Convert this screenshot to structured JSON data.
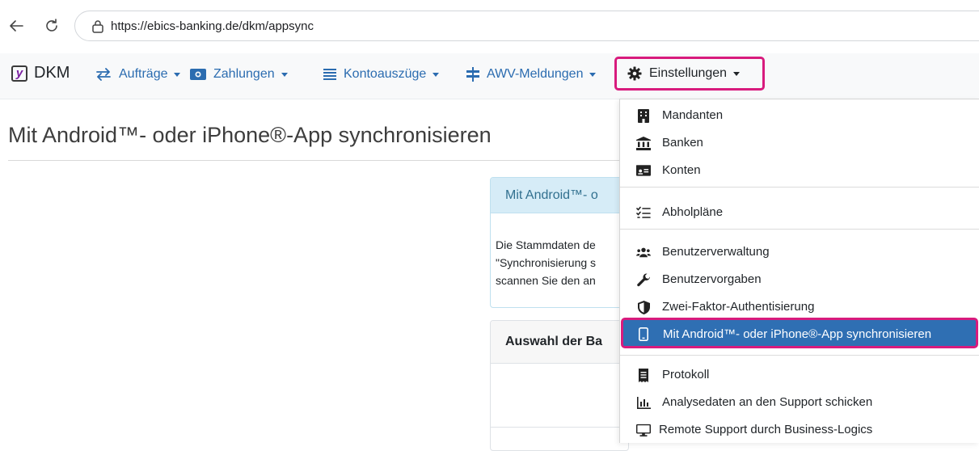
{
  "browser": {
    "url": "https://ebics-banking.de/dkm/appsync"
  },
  "navbar": {
    "brand_logo": "y",
    "brand_name": "DKM",
    "items": [
      {
        "label": "Aufträge",
        "icon": "arrows-exchange-icon"
      },
      {
        "label": "Zahlungen",
        "icon": "money-bill-icon"
      },
      {
        "label": "Kontoauszüge",
        "icon": "list-lines-icon"
      },
      {
        "label": "AWV-Meldungen",
        "icon": "transfer-bars-icon"
      },
      {
        "label": "Einstellungen",
        "icon": "gear-icon"
      }
    ]
  },
  "page": {
    "title": "Mit Android™- oder iPhone®-App synchronisieren"
  },
  "info_card": {
    "title": "Mit Android™- o",
    "lines": [
      "Die Stammdaten de",
      "\"Synchronisierung s",
      "scannen Sie den an"
    ]
  },
  "bank_card": {
    "title": "Auswahl der Ba"
  },
  "dropdown": {
    "items": [
      {
        "label": "Mandanten",
        "icon": "building-icon"
      },
      {
        "label": "Banken",
        "icon": "bank-icon"
      },
      {
        "label": "Konten",
        "icon": "id-card-icon"
      },
      {
        "label": "Abholpläne",
        "icon": "checklist-icon"
      },
      {
        "label": "Benutzerverwaltung",
        "icon": "users-icon"
      },
      {
        "label": "Benutzervorgaben",
        "icon": "wrench-icon"
      },
      {
        "label": "Zwei-Faktor-Authentisierung",
        "icon": "shield-icon"
      },
      {
        "label": "Mit Android™- oder iPhone®-App synchronisieren",
        "icon": "mobile-phone-icon"
      },
      {
        "label": "Protokoll",
        "icon": "receipt-icon"
      },
      {
        "label": "Analysedaten an den Support schicken",
        "icon": "bar-chart-icon"
      },
      {
        "label": "Remote Support durch Business-Logics",
        "icon": "desktop-icon"
      }
    ]
  },
  "colors": {
    "link": "#2b6cb0",
    "highlight": "#d81b7d",
    "active_item": "#2f6fb3",
    "info_header": "#d6ecf7"
  }
}
